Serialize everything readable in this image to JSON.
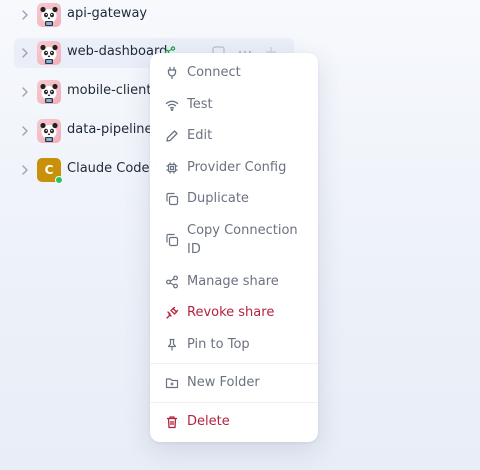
{
  "tree": {
    "items": [
      {
        "label": "api-gateway"
      },
      {
        "label": "web-dashboard"
      },
      {
        "label": "mobile-client"
      },
      {
        "label": "data-pipeline"
      },
      {
        "label": "Claude Code · ",
        "avatar_letter": "C"
      }
    ]
  },
  "context_menu": {
    "items": [
      {
        "label": "Connect",
        "icon": "plug-icon"
      },
      {
        "label": "Test",
        "icon": "wifi-icon"
      },
      {
        "label": "Edit",
        "icon": "pencil-icon"
      },
      {
        "label": "Provider Config",
        "icon": "chip-icon"
      },
      {
        "label": "Duplicate",
        "icon": "copy-icon"
      },
      {
        "label": "Copy Connection ID",
        "icon": "copy-icon"
      },
      {
        "label": "Manage share",
        "icon": "share-icon"
      },
      {
        "label": "Revoke share",
        "icon": "unplug-icon",
        "danger": true
      },
      {
        "label": "Pin to Top",
        "icon": "pin-icon"
      },
      {
        "label": "New Folder",
        "icon": "folder-plus-icon"
      },
      {
        "label": "Delete",
        "icon": "trash-icon",
        "danger": true
      }
    ]
  },
  "colors": {
    "danger": "#b4233c",
    "menu_text": "#6b7280",
    "avatar_claude": "#c9900a",
    "online": "#22c55e",
    "share_active": "#16a34a"
  }
}
